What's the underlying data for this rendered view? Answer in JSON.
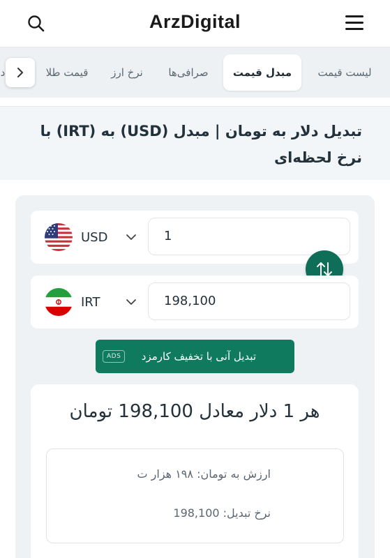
{
  "header": {
    "logo": "ArzDigital",
    "search_icon": "search-icon",
    "menu_icon": "hamburger-menu-icon"
  },
  "tabs": [
    {
      "label": "لیست قیمت",
      "active": false
    },
    {
      "label": "مبدل قیمت",
      "active": true
    },
    {
      "label": "صرافی‌ها",
      "active": false
    },
    {
      "label": "نرخ ارز",
      "active": false
    },
    {
      "label": "قیمت طلا",
      "active": false
    },
    {
      "label": "د",
      "active": false
    }
  ],
  "page": {
    "title": "تبدیل دلار به تومان | مبدل (USD) به (IRT) با نرخ لحظه‌ای"
  },
  "converter": {
    "from": {
      "code": "USD",
      "amount": "1",
      "flag": "us-flag-icon"
    },
    "to": {
      "code": "IRT",
      "amount": "198,100",
      "flag": "iran-flag-icon"
    },
    "swap_icon": "swap-arrows-icon",
    "cta_label": "تبدیل آنی با تخفیف کارمزد",
    "cta_badge": "ADS",
    "result_headline": "هر 1 دلار معادل 198,100 تومان",
    "value_label": "ارزش به تومان:",
    "value_text": "۱۹۸ هزار ت",
    "rate_label": "نرخ تبدیل:",
    "rate_value": "198,100"
  },
  "colors": {
    "accent": "#0f7a5e",
    "swap": "#0f6e58",
    "tab_bar": "#eef1f4",
    "card_bg": "#eef2f5"
  }
}
